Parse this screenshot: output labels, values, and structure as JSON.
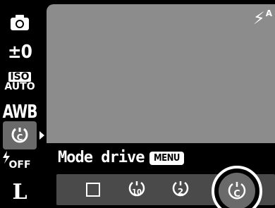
{
  "sidebar": {
    "items": [
      {
        "name": "camera-icon"
      },
      {
        "label": "±0"
      },
      {
        "top": "ISO",
        "bottom": "AUTO"
      },
      {
        "label": "AWB"
      },
      {
        "name": "self-timer-custom-icon"
      },
      {
        "label": "OFF"
      },
      {
        "label": "L"
      }
    ]
  },
  "viewport": {
    "flash_symbol": "⚡",
    "flash_sup": "A"
  },
  "panel": {
    "title": "Mode drive",
    "menu_label": "MENU",
    "options": [
      {
        "name": "single-shot-icon"
      },
      {
        "name": "self-timer-10s-icon",
        "label": "10"
      },
      {
        "name": "self-timer-2s-icon",
        "label": "2"
      },
      {
        "name": "self-timer-custom-icon",
        "label": "C"
      }
    ],
    "selected_index": 3
  }
}
